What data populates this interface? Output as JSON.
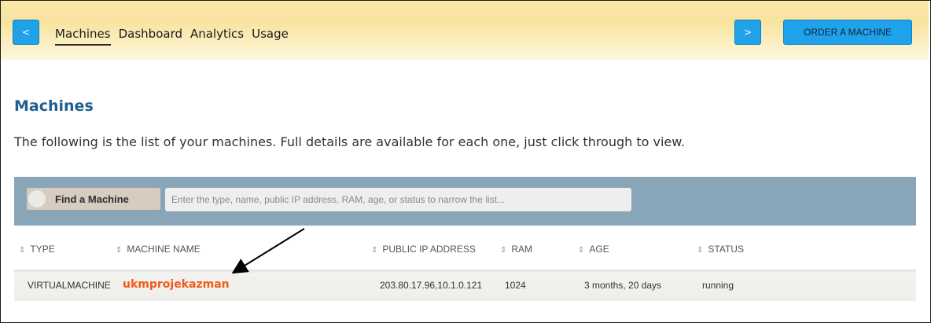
{
  "nav": {
    "back_label": "<",
    "forward_label": ">",
    "order_label": "ORDER A MACHINE",
    "tabs": [
      {
        "label": "Machines",
        "active": true
      },
      {
        "label": "Dashboard"
      },
      {
        "label": "Analytics"
      },
      {
        "label": "Usage"
      }
    ]
  },
  "page": {
    "title": "Machines",
    "intro": "The following is the list of your machines. Full details are available for each one, just click through to view."
  },
  "search": {
    "label": "Find a Machine",
    "placeholder": "Enter the type, name, public IP address, RAM, age, or status to narrow the list..."
  },
  "table": {
    "headers": [
      "TYPE",
      "MACHINE NAME",
      "PUBLIC IP ADDRESS",
      "RAM",
      "AGE",
      "STATUS"
    ],
    "rows": [
      {
        "type": "VIRTUALMACHINE",
        "name": "ukmprojekazman",
        "ip": "203.80.17.96,10.1.0.121",
        "ram": "1024",
        "age": "3 months, 20 days",
        "status": "running"
      }
    ]
  },
  "colors": {
    "accent_button": "#1fa2e9",
    "title": "#1e5f8f",
    "machine_link": "#f05a19",
    "search_bar": "#88a6b8"
  },
  "icons": [
    "sort-icon",
    "search-icon",
    "arrow-annotation"
  ]
}
